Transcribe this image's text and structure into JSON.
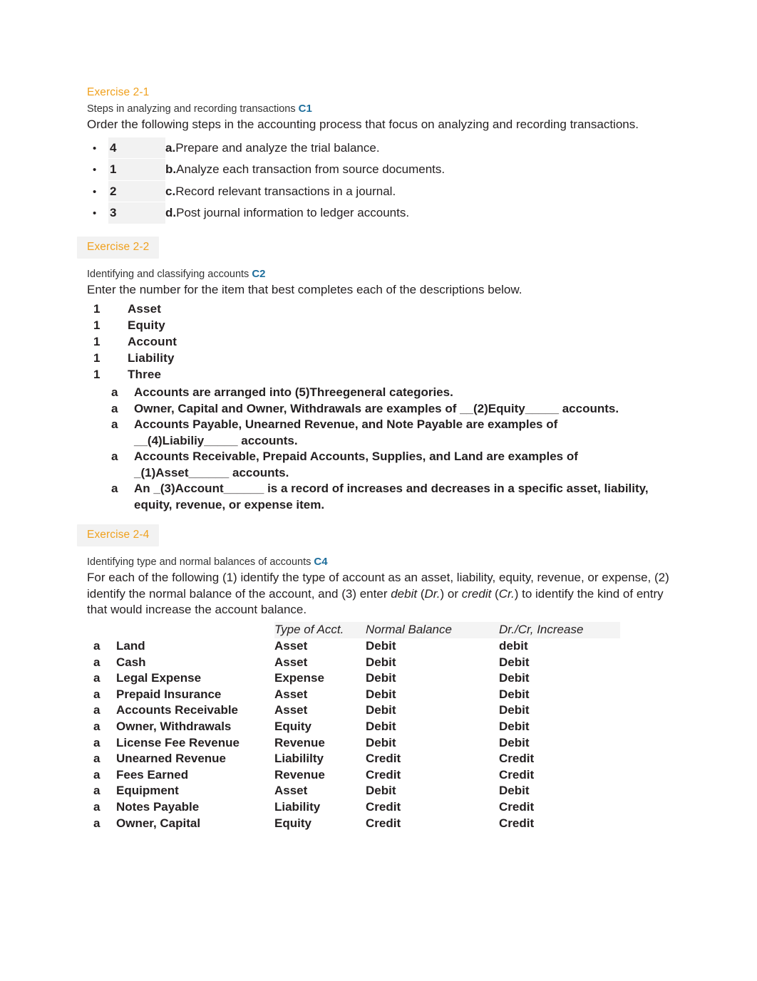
{
  "document": {
    "accent_orange": "#f0a11e",
    "accent_blue": "#1e6e9c",
    "text_color": "#231f20"
  },
  "exercise_2_1": {
    "heading": "Exercise 2-1",
    "subheading": "Steps in analyzing and recording transactions",
    "code": "C1",
    "instructions": "Order the following steps in the accounting process that focus on analyzing and recording transactions.",
    "bullet": "•",
    "steps": [
      {
        "answer": "4",
        "letter": "a.",
        "text": "Prepare and analyze the trial balance."
      },
      {
        "answer": "1",
        "letter": "b.",
        "text": "Analyze each transaction from source documents."
      },
      {
        "answer": "2",
        "letter": "c.",
        "text": "Record relevant transactions in a journal."
      },
      {
        "answer": "3",
        "letter": "d.",
        "text": "Post journal information to ledger accounts."
      }
    ]
  },
  "exercise_2_2": {
    "heading": "Exercise 2-2",
    "subheading": "Identifying and classifying accounts",
    "code": "C2",
    "instructions": "Enter the number for the item that best completes each of the descriptions below.",
    "terms": [
      {
        "num": "1",
        "label": "Asset"
      },
      {
        "num": "1",
        "label": "Equity"
      },
      {
        "num": "1",
        "label": "Account"
      },
      {
        "num": "1",
        "label": "Liability"
      },
      {
        "num": "1",
        "label": "Three"
      }
    ],
    "descriptions": [
      {
        "marker": "a",
        "line1": "Accounts are arranged into (5)Threegeneral categories.",
        "line2": ""
      },
      {
        "marker": "a",
        "line1": "Owner, Capital and Owner, Withdrawals are examples of __(2)Equity_____ accounts.",
        "line2": ""
      },
      {
        "marker": "a",
        "line1": "Accounts Payable, Unearned Revenue, and Note Payable are examples of",
        "line2": "__(4)Liabiliy_____ accounts."
      },
      {
        "marker": "a",
        "line1": "Accounts Receivable, Prepaid Accounts, Supplies, and Land are examples of",
        "line2": "_(1)Asset______ accounts."
      },
      {
        "marker": "a",
        "line1": "An _(3)Account______ is a record of increases and decreases in a specific asset, liability,",
        "line2": "equity, revenue, or expense item."
      }
    ]
  },
  "exercise_2_4": {
    "heading": "Exercise 2-4",
    "subheading": "Identifying type and normal balances of accounts",
    "code": "C4",
    "instructions_line1": "For each of the following (1) identify the type of account as an asset, liability, equity, revenue, or expense,",
    "instructions_line2_a": "(2) identify the normal balance of the account, and (3) enter ",
    "instructions_line2_b": "debit",
    "instructions_line2_c": " (",
    "instructions_line2_d": "Dr.",
    "instructions_line2_e": ") or ",
    "instructions_line2_f": "credit",
    "instructions_line2_g": " (",
    "instructions_line2_h": "Cr.",
    "instructions_line2_i": ") to identify the kind of",
    "instructions_line3": "entry that would increase the account balance.",
    "columns": [
      "",
      "",
      "Type of Acct.",
      "Normal Balance",
      "Dr./Cr, Increase"
    ],
    "rows": [
      {
        "marker": "a",
        "account": "Land",
        "type": "Asset",
        "normal": "Debit",
        "increase": "debit"
      },
      {
        "marker": "a",
        "account": "Cash",
        "type": "Asset",
        "normal": "Debit",
        "increase": "Debit"
      },
      {
        "marker": "a",
        "account": "Legal Expense",
        "type": "Expense",
        "normal": "Debit",
        "increase": "Debit"
      },
      {
        "marker": "a",
        "account": "Prepaid Insurance",
        "type": "Asset",
        "normal": "Debit",
        "increase": "Debit"
      },
      {
        "marker": "a",
        "account": "Accounts Receivable",
        "type": "Asset",
        "normal": "Debit",
        "increase": "Debit"
      },
      {
        "marker": "a",
        "account": "Owner, Withdrawals",
        "type": "Equity",
        "normal": "Debit",
        "increase": "Debit"
      },
      {
        "marker": "a",
        "account": "License Fee Revenue",
        "type": "Revenue",
        "normal": "Debit",
        "increase": "Debit"
      },
      {
        "marker": "a",
        "account": "Unearned Revenue",
        "type": "Liabililty",
        "normal": "Credit",
        "increase": "Credit"
      },
      {
        "marker": "a",
        "account": "Fees Earned",
        "type": "Revenue",
        "normal": "Credit",
        "increase": "Credit"
      },
      {
        "marker": "a",
        "account": "Equipment",
        "type": "Asset",
        "normal": "Debit",
        "increase": "Debit"
      },
      {
        "marker": "a",
        "account": "Notes Payable",
        "type": "Liability",
        "normal": "Credit",
        "increase": "Credit"
      },
      {
        "marker": "a",
        "account": "Owner, Capital",
        "type": "Equity",
        "normal": "Credit",
        "increase": "Credit"
      }
    ]
  }
}
